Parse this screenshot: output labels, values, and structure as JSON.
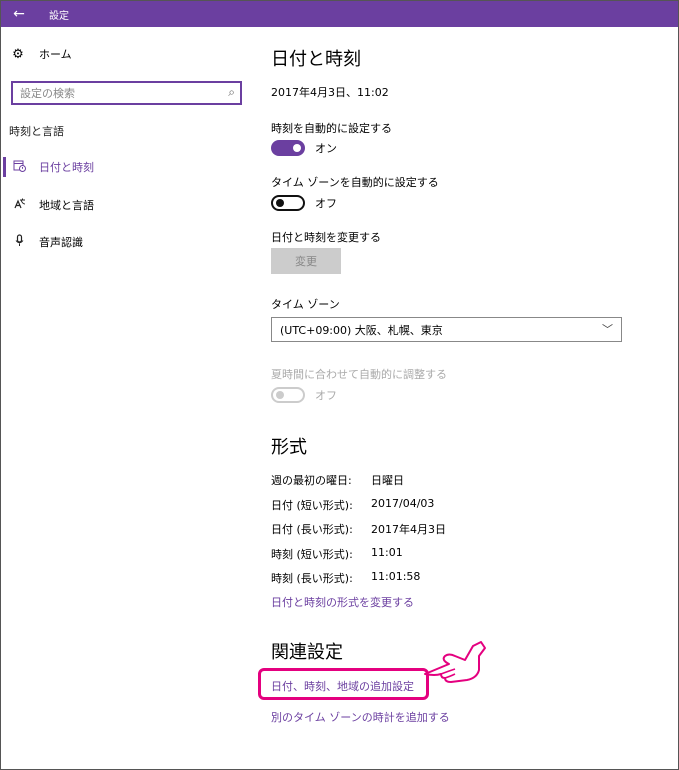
{
  "window": {
    "title": "設定",
    "back_icon": "←"
  },
  "sidebar": {
    "home_label": "ホーム",
    "search_placeholder": "設定の検索",
    "section_label": "時刻と言語",
    "items": [
      {
        "label": "日付と時刻",
        "icon": "date-time-icon",
        "active": true
      },
      {
        "label": "地域と言語",
        "icon": "region-language-icon",
        "active": false
      },
      {
        "label": "音声認識",
        "icon": "microphone-icon",
        "active": false
      }
    ]
  },
  "main": {
    "title": "日付と時刻",
    "current_datetime": "2017年4月3日、11:02",
    "auto_time": {
      "label": "時刻を自動的に設定する",
      "state": "オン"
    },
    "auto_timezone": {
      "label": "タイム ゾーンを自動的に設定する",
      "state": "オフ"
    },
    "change_datetime": {
      "label": "日付と時刻を変更する",
      "button": "変更"
    },
    "timezone": {
      "label": "タイム ゾーン",
      "value": "(UTC+09:00) 大阪、札幌、東京"
    },
    "dst": {
      "label": "夏時間に合わせて自動的に調整する",
      "state": "オフ"
    },
    "format": {
      "title": "形式",
      "rows": [
        {
          "label": "週の最初の曜日:",
          "value": "日曜日"
        },
        {
          "label": "日付 (短い形式):",
          "value": "2017/04/03"
        },
        {
          "label": "日付 (長い形式):",
          "value": "2017年4月3日"
        },
        {
          "label": "時刻 (短い形式):",
          "value": "11:01"
        },
        {
          "label": "時刻 (長い形式):",
          "value": "11:01:58"
        }
      ],
      "change_link": "日付と時刻の形式を変更する"
    },
    "related": {
      "title": "関連設定",
      "link1": "日付、時刻、地域の追加設定",
      "link2": "別のタイム ゾーンの時計を追加する"
    }
  },
  "colors": {
    "accent": "#6b3fa0",
    "highlight": "#e4007f"
  }
}
